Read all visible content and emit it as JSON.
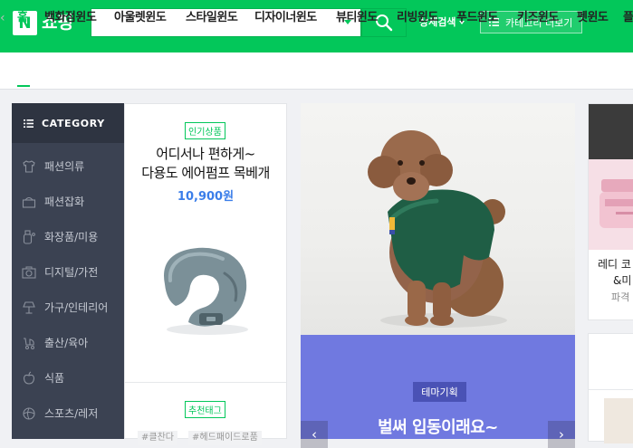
{
  "header": {
    "logo_letter": "N",
    "logo_text": "쇼핑",
    "search_placeholder": "",
    "detail_search_label": "상세검색",
    "category_more_label": "카테고리 더보기"
  },
  "nav": {
    "items": [
      "홈",
      "백화점윈도",
      "아울렛윈도",
      "스타일윈도",
      "디자이너윈도",
      "뷰티윈도",
      "리빙윈도",
      "푸드윈도",
      "키즈윈도",
      "펫윈도",
      "플"
    ]
  },
  "sidebar": {
    "title": "CATEGORY",
    "items": [
      "패션의류",
      "패션잡화",
      "화장품/미용",
      "디지털/가전",
      "가구/인테리어",
      "출산/육아",
      "식품",
      "스포츠/레저"
    ]
  },
  "product": {
    "badge": "인기상품",
    "title_line1": "어디서나 편하게~",
    "title_line2": "다용도 에어펌프 목베개",
    "price": "10,900원",
    "tag_badge": "추천태그",
    "tags": [
      "#클찬다",
      "#헤드패이드로품"
    ]
  },
  "banner": {
    "badge": "테마기획",
    "title": "벌써 입동이래요~"
  },
  "side_card": {
    "line1": "레디 코",
    "line2": "&미",
    "line3": "파격"
  },
  "colors": {
    "brand_green": "#03c75a",
    "price_blue": "#3b7ee9",
    "banner_purple": "#7079e0",
    "sidebar_dark": "#3b4252"
  }
}
